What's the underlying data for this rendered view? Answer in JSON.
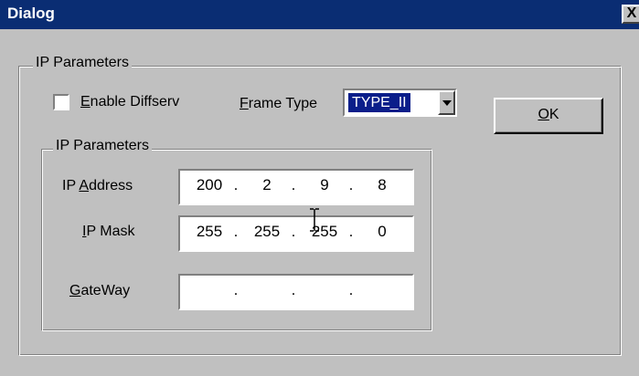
{
  "window": {
    "title": "Dialog",
    "close_glyph": "X"
  },
  "outer_group": {
    "legend": "IP Parameters"
  },
  "enable_diffserv": {
    "prefix": "E",
    "rest": "nable Diffserv",
    "checked": false
  },
  "frame_type": {
    "prefix": "F",
    "rest": "rame Type",
    "selected": "TYPE_II"
  },
  "ok_button": {
    "prefix": "O",
    "rest": "K"
  },
  "inner_group": {
    "legend": "IP Parameters"
  },
  "ip_address": {
    "label_pre": "IP ",
    "label_u": "A",
    "label_post": "ddress",
    "octets": [
      "200",
      "2",
      "9",
      "8"
    ]
  },
  "ip_mask": {
    "label_u": "I",
    "label_post": "P Mask",
    "octets": [
      "255",
      "255",
      "255",
      "0"
    ]
  },
  "gateway": {
    "label_u": "G",
    "label_post": "ateWay",
    "octets": [
      "",
      "",
      "",
      ""
    ]
  },
  "separator": "."
}
